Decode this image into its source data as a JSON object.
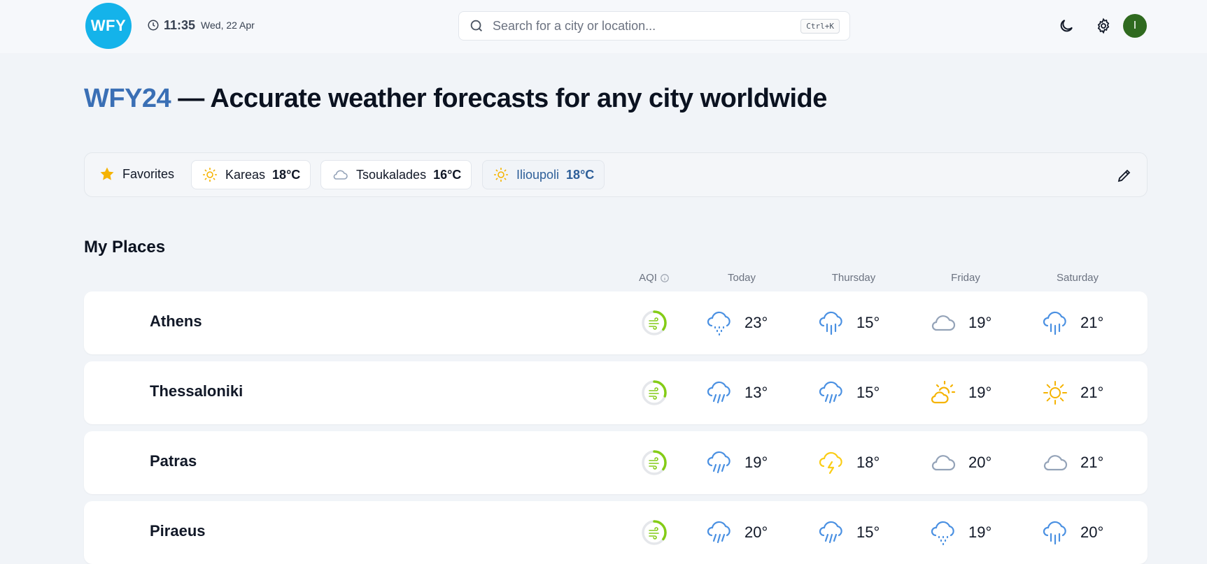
{
  "header": {
    "logo": "WFY",
    "time": "11:35",
    "date": "Wed, 22 Apr",
    "search_placeholder": "Search for a city or location...",
    "search_shortcut": "Ctrl+K",
    "avatar_initial": "I"
  },
  "hero": {
    "brand": "WFY24",
    "tagline": " — Accurate weather forecasts for any city worldwide"
  },
  "favorites": {
    "label": "Favorites",
    "items": [
      {
        "name": "Kareas",
        "temp": "18°C",
        "icon": "sun-icon"
      },
      {
        "name": "Tsoukalades",
        "temp": "16°C",
        "icon": "cloud-icon"
      },
      {
        "name": "Ilioupoli",
        "temp": "18°C",
        "icon": "sun-icon",
        "active": true
      }
    ]
  },
  "places": {
    "title": "My Places",
    "columns": [
      "AQI",
      "Today",
      "Thursday",
      "Friday",
      "Saturday"
    ],
    "rows": [
      {
        "city": "Athens",
        "aqi_level": 0.35,
        "forecast": [
          {
            "icon": "drizzle-icon",
            "temp": "23°"
          },
          {
            "icon": "rain-icon",
            "temp": "15°"
          },
          {
            "icon": "cloud-icon",
            "temp": "19°"
          },
          {
            "icon": "rain-icon",
            "temp": "21°"
          }
        ]
      },
      {
        "city": "Thessaloniki",
        "aqi_level": 0.3,
        "forecast": [
          {
            "icon": "heavy-rain-icon",
            "temp": "13°"
          },
          {
            "icon": "heavy-rain-icon",
            "temp": "15°"
          },
          {
            "icon": "partly-cloudy-icon",
            "temp": "19°"
          },
          {
            "icon": "sun-icon",
            "temp": "21°"
          }
        ]
      },
      {
        "city": "Patras",
        "aqi_level": 0.35,
        "forecast": [
          {
            "icon": "heavy-rain-icon",
            "temp": "19°"
          },
          {
            "icon": "thunderstorm-icon",
            "temp": "18°"
          },
          {
            "icon": "cloud-icon",
            "temp": "20°"
          },
          {
            "icon": "cloud-icon",
            "temp": "21°"
          }
        ]
      },
      {
        "city": "Piraeus",
        "aqi_level": 0.35,
        "forecast": [
          {
            "icon": "heavy-rain-icon",
            "temp": "20°"
          },
          {
            "icon": "heavy-rain-icon",
            "temp": "15°"
          },
          {
            "icon": "drizzle-icon",
            "temp": "19°"
          },
          {
            "icon": "rain-icon",
            "temp": "20°"
          }
        ]
      }
    ]
  },
  "colors": {
    "logo_bg": "#14b3ea",
    "brand": "#3a6fb5",
    "avatar_bg": "#2f6a1f",
    "rain": "#4a90e2",
    "sun": "#f5b301",
    "cloud": "#94a3b8",
    "aqi_good": "#84cc16"
  }
}
